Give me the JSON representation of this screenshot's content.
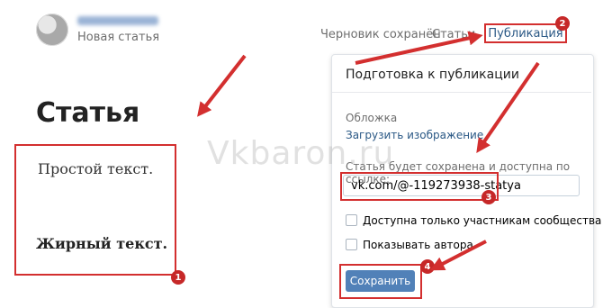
{
  "header": {
    "author_name_blurred": "Имя автора",
    "status": "Новая статья",
    "draft_saved": "Черновик сохранён",
    "articles_menu": "Статьи",
    "publish_button": "Публикация"
  },
  "article": {
    "title": "Статья",
    "plain_text": "Простой текст.",
    "bold_text": "Жирный текст."
  },
  "publish_panel": {
    "title": "Подготовка к публикации",
    "cover_label": "Обложка",
    "upload_image_link": "Загрузить изображение",
    "url_caption": "Статья будет сохранена и доступна по ссылке:",
    "url_value": "vk.com/@-119273938-statya",
    "option_members_only": "Доступна только участникам сообщества",
    "option_show_author": "Показывать автора",
    "save_button": "Сохранить"
  },
  "badges": {
    "b1": "1",
    "b2": "2",
    "b3": "3",
    "b4": "4"
  },
  "watermark": "Vkbaron.ru",
  "colors": {
    "accent_red": "#d32f2f",
    "link_blue": "#2a5885",
    "button_blue": "#5181b8"
  },
  "icons": {
    "avatar": "avatar-image",
    "articles_dropdown": "chevron-down-icon",
    "publish_dropdown": "chevron-down-icon"
  }
}
